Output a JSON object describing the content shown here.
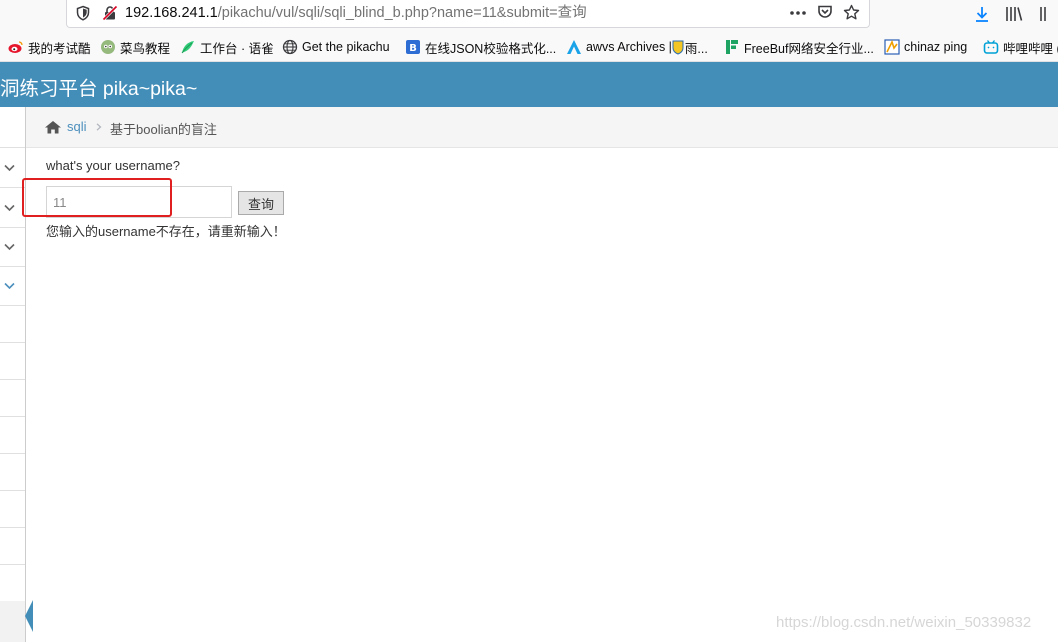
{
  "browser": {
    "url_host": "192.168.241.1",
    "url_path": "/pikachu/vul/sqli/sqli_blind_b.php?name=11&submit=查询",
    "page_actions_icon": "more-horizontal-icon",
    "pocket_icon": "pocket-icon",
    "bookmark_star_icon": "star-icon",
    "toolbar_icons": [
      "download-icon",
      "library-icon",
      "sidebar-icon"
    ]
  },
  "bookmarks": [
    {
      "label": "我的考试酷",
      "icon": "weibo-icon"
    },
    {
      "label": "菜鸟教程",
      "icon": "runoob-icon"
    },
    {
      "label": "工作台 · 语雀",
      "icon": "yuque-icon"
    },
    {
      "label": "Get the pikachu",
      "icon": "globe-icon"
    },
    {
      "label": "在线JSON校验格式化...",
      "icon": "json-icon"
    },
    {
      "label": "awvs Archives | ",
      "icon": "awvs-icon"
    },
    {
      "label": "雨...",
      "icon": "shield-badge-icon"
    },
    {
      "label": "FreeBuf网络安全行业...",
      "icon": "freebuf-icon"
    },
    {
      "label": "chinaz ping",
      "icon": "chinaz-icon"
    },
    {
      "label": "哔哩哔哩 (",
      "icon": "bilibili-icon"
    }
  ],
  "app": {
    "title": "洞练习平台 pika~pika~",
    "header_color": "#438eb9"
  },
  "breadcrumb": {
    "home_icon": "home-icon",
    "link": "sqli",
    "current": "基于boolian的盲注"
  },
  "form": {
    "prompt": "what's your username?",
    "input_value": "11",
    "submit_label": "查询",
    "result": "您输入的username不存在，请重新输入！"
  },
  "watermark": "https://blog.csdn.net/weixin_50339832",
  "colors": {
    "accent": "#438eb9",
    "highlight": "#e02020",
    "link": "#4c8fbd"
  }
}
